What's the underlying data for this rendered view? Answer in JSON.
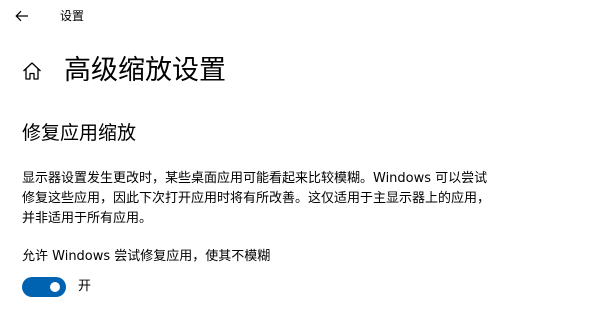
{
  "window": {
    "app_title": "设置",
    "back_icon": "back-arrow-icon"
  },
  "page": {
    "home_icon": "home-icon",
    "title": "高级缩放设置"
  },
  "section": {
    "title": "修复应用缩放",
    "description": "显示器设置发生更改时，某些桌面应用可能看起来比较模糊。Windows 可以尝试修复这些应用，因此下次打开应用时将有所改善。这仅适用于主显示器上的应用，并非适用于所有应用。",
    "toggle": {
      "label": "允许 Windows 尝试修复应用，使其不模糊",
      "state_text": "开",
      "is_on": true
    }
  },
  "colors": {
    "accent": "#0063b1",
    "background": "#ffffff",
    "text": "#000000"
  }
}
